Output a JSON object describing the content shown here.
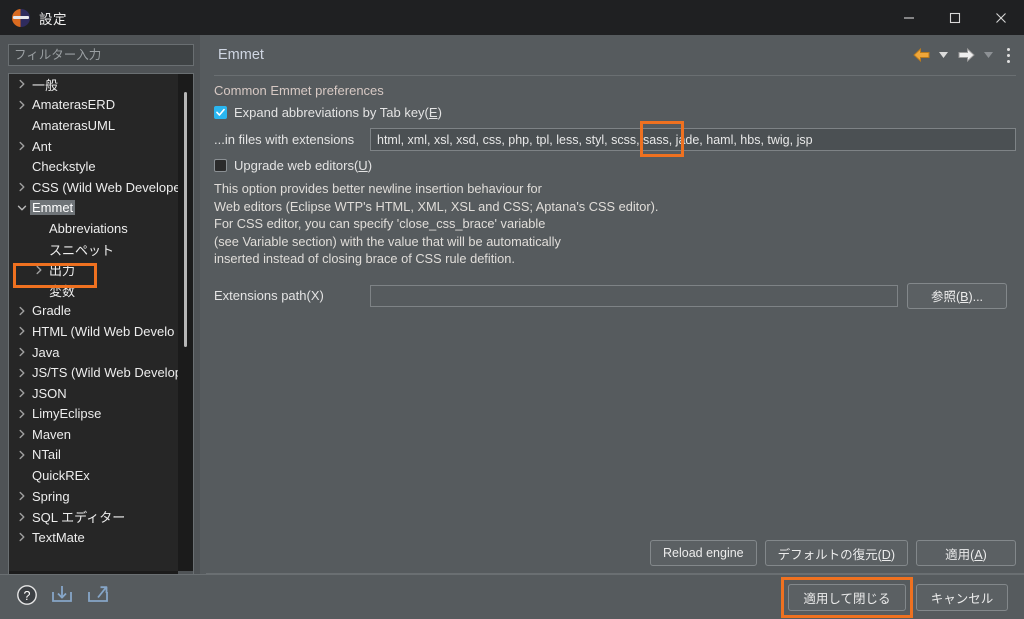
{
  "window": {
    "title": "設定",
    "icon": "eclipse-icon",
    "minimize_label": "最小化",
    "maximize_label": "最大化",
    "close_label": "閉じる"
  },
  "sidebar": {
    "filter_placeholder": "フィルター入力",
    "filter_value": "",
    "items": [
      {
        "label": "一般",
        "level": 0,
        "expandable": true,
        "expanded": false,
        "selected": false
      },
      {
        "label": "AmaterasERD",
        "level": 0,
        "expandable": true,
        "expanded": false,
        "selected": false
      },
      {
        "label": "AmaterasUML",
        "level": 0,
        "expandable": false,
        "expanded": false,
        "selected": false
      },
      {
        "label": "Ant",
        "level": 0,
        "expandable": true,
        "expanded": false,
        "selected": false
      },
      {
        "label": "Checkstyle",
        "level": 0,
        "expandable": false,
        "expanded": false,
        "selected": false
      },
      {
        "label": "CSS (Wild Web Developer",
        "level": 0,
        "expandable": true,
        "expanded": false,
        "selected": false
      },
      {
        "label": "Emmet",
        "level": 0,
        "expandable": true,
        "expanded": true,
        "selected": true
      },
      {
        "label": "Abbreviations",
        "level": 1,
        "expandable": false,
        "expanded": false,
        "selected": false
      },
      {
        "label": "スニペット",
        "level": 1,
        "expandable": false,
        "expanded": false,
        "selected": false
      },
      {
        "label": "出力",
        "level": 1,
        "expandable": true,
        "expanded": false,
        "selected": false
      },
      {
        "label": "変数",
        "level": 1,
        "expandable": false,
        "expanded": false,
        "selected": false
      },
      {
        "label": "Gradle",
        "level": 0,
        "expandable": true,
        "expanded": false,
        "selected": false
      },
      {
        "label": "HTML (Wild Web Develo",
        "level": 0,
        "expandable": true,
        "expanded": false,
        "selected": false
      },
      {
        "label": "Java",
        "level": 0,
        "expandable": true,
        "expanded": false,
        "selected": false
      },
      {
        "label": "JS/TS (Wild Web Developr",
        "level": 0,
        "expandable": true,
        "expanded": false,
        "selected": false
      },
      {
        "label": "JSON",
        "level": 0,
        "expandable": true,
        "expanded": false,
        "selected": false
      },
      {
        "label": "LimyEclipse",
        "level": 0,
        "expandable": true,
        "expanded": false,
        "selected": false
      },
      {
        "label": "Maven",
        "level": 0,
        "expandable": true,
        "expanded": false,
        "selected": false
      },
      {
        "label": "NTail",
        "level": 0,
        "expandable": true,
        "expanded": false,
        "selected": false
      },
      {
        "label": "QuickREx",
        "level": 0,
        "expandable": false,
        "expanded": false,
        "selected": false
      },
      {
        "label": "Spring",
        "level": 0,
        "expandable": true,
        "expanded": false,
        "selected": false
      },
      {
        "label": "SQL エディター",
        "level": 0,
        "expandable": true,
        "expanded": false,
        "selected": false
      },
      {
        "label": "TextMate",
        "level": 0,
        "expandable": true,
        "expanded": false,
        "selected": false
      }
    ]
  },
  "page": {
    "title": "Emmet",
    "nav": {
      "back_label": "戻る",
      "back_menu_label": "戻る履歴",
      "forward_label": "進む",
      "forward_menu_label": "進む履歴",
      "menu_label": "ビュー・メニュー"
    },
    "section_heading": "Common Emmet preferences",
    "expand_abbrev": {
      "label": "Expand abbreviations by Tab key(E)",
      "label_pre": "Expand abbreviations by Tab key(",
      "mnemonic": "E",
      "label_post": ")",
      "checked": true
    },
    "extensions": {
      "label": "...in files with extensions",
      "value": "html, xml, xsl, xsd, css, php, tpl, less, styl, scss, sass, jade, haml, hbs, twig, jsp",
      "highlighted_fragment": ", jsp"
    },
    "upgrade_web_editors": {
      "label": "Upgrade web editors(U)",
      "label_pre": "Upgrade web editors(",
      "mnemonic": "U",
      "label_post": ")",
      "checked": false
    },
    "description": "This option provides better newline insertion behaviour for\nWeb editors (Eclipse WTP's HTML, XML, XSL and CSS; Aptana's CSS editor).\nFor CSS editor, you can specify 'close_css_brace' variable\n(see Variable section) with the value that will be automatically\ninserted instead of closing brace of CSS rule defition.",
    "extensions_path": {
      "label": "Extensions path(X)",
      "value": "",
      "browse_label": "参照(B)...",
      "browse_label_pre": "参照(",
      "browse_mnemonic": "B",
      "browse_label_post": ")..."
    },
    "buttons": {
      "reload_engine": "Reload engine",
      "restore_defaults": "デフォルトの復元(D)",
      "restore_defaults_pre": "デフォルトの復元(",
      "restore_defaults_mnemonic": "D",
      "restore_defaults_post": ")",
      "apply": "適用(A)",
      "apply_pre": "適用(",
      "apply_mnemonic": "A",
      "apply_post": ")"
    }
  },
  "footer": {
    "help_icon": "help-icon",
    "import_icon": "import-icon",
    "export_icon": "export-icon",
    "apply_and_close": "適用して閉じる",
    "cancel": "キャンセル"
  },
  "colors": {
    "highlight": "#ef7120",
    "checkbox_on": "#2ab6f0",
    "title_text": "#cfd6e2",
    "back_arrow": "#f0a73a",
    "forward_arrow": "#e8e8e8"
  }
}
